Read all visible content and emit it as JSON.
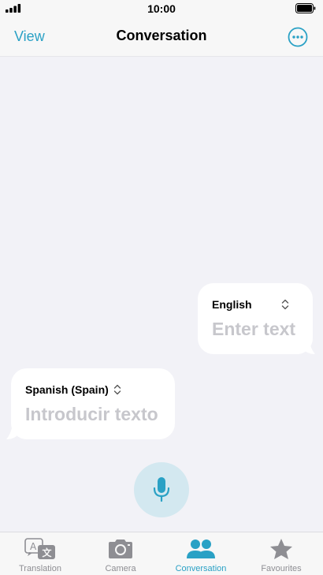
{
  "status_bar": {
    "time": "10:00"
  },
  "nav": {
    "left_label": "View",
    "title": "Conversation"
  },
  "bubbles": {
    "english": {
      "language": "English",
      "placeholder": "Enter text"
    },
    "spanish": {
      "language": "Spanish (Spain)",
      "placeholder": "Introducir texto"
    }
  },
  "tabs": [
    {
      "label": "Translation",
      "icon": "translation-icon",
      "active": false
    },
    {
      "label": "Camera",
      "icon": "camera-icon",
      "active": false
    },
    {
      "label": "Conversation",
      "icon": "people-icon",
      "active": true
    },
    {
      "label": "Favourites",
      "icon": "star-icon",
      "active": false
    }
  ],
  "colors": {
    "accent": "#2aa1c5",
    "inactive": "#8e8e93",
    "mic_bg": "#d3e8f0"
  }
}
